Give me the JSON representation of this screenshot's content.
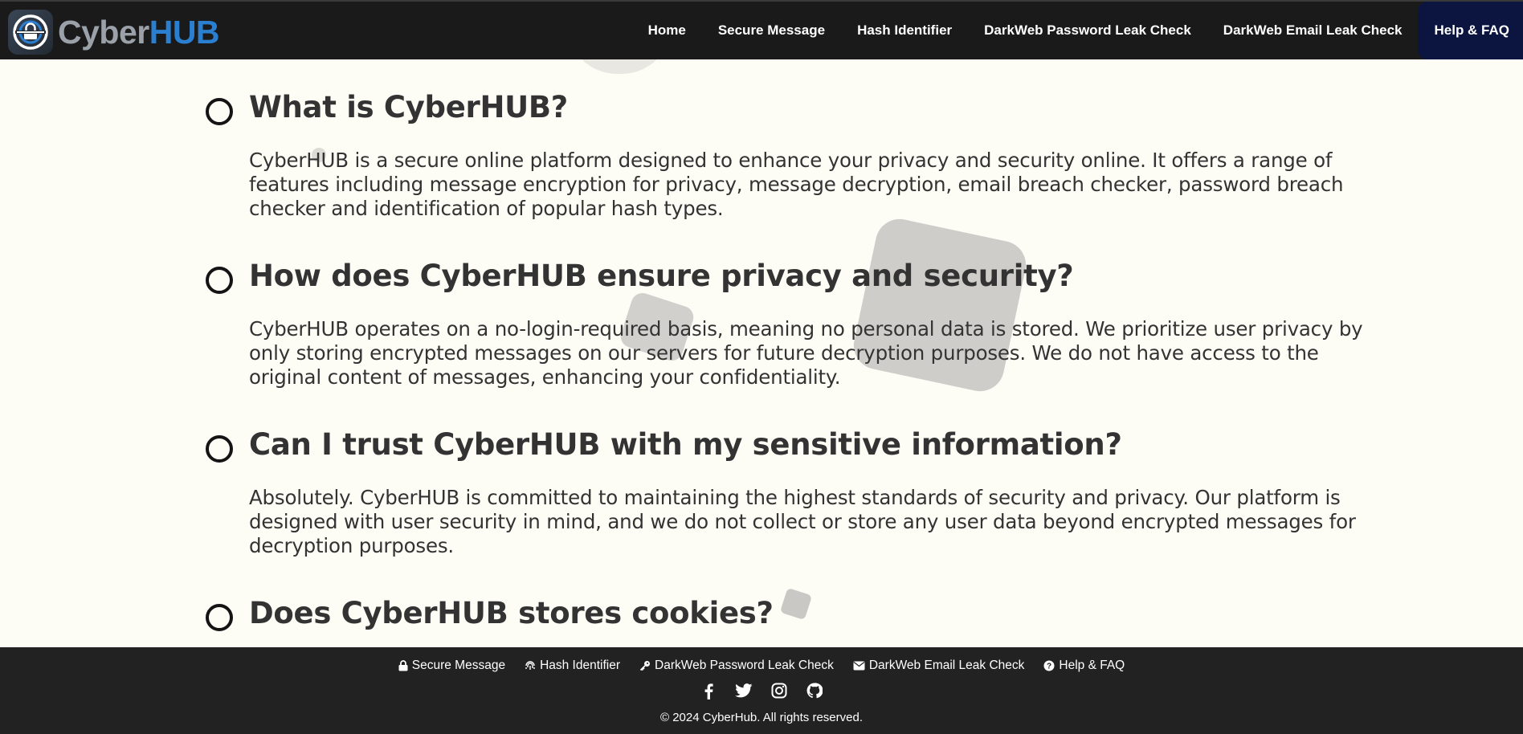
{
  "header": {
    "brand_part1": "Cyber",
    "brand_part2": "HUB",
    "nav": [
      {
        "label": "Home"
      },
      {
        "label": "Secure Message"
      },
      {
        "label": "Hash Identifier"
      },
      {
        "label": "DarkWeb Password Leak Check"
      },
      {
        "label": "DarkWeb Email Leak Check"
      },
      {
        "label": "Help & FAQ",
        "active": true
      }
    ]
  },
  "faq": [
    {
      "question": "What is CyberHUB?",
      "answer": "CyberHUB is a secure online platform designed to enhance your privacy and security online. It offers a range of features including message encryption for privacy, message decryption, email breach checker, password breach checker and identification of popular hash types."
    },
    {
      "question": "How does CyberHUB ensure privacy and security?",
      "answer": "CyberHUB operates on a no-login-required basis, meaning no personal data is stored. We prioritize user privacy by only storing encrypted messages on our servers for future decryption purposes. We do not have access to the original content of messages, enhancing your confidentiality."
    },
    {
      "question": "Can I trust CyberHUB with my sensitive information?",
      "answer": "Absolutely. CyberHUB is committed to maintaining the highest standards of security and privacy. Our platform is designed with user security in mind, and we do not collect or store any user data beyond encrypted messages for decryption purposes."
    },
    {
      "question": "Does CyberHUB stores cookies?",
      "answer": ""
    }
  ],
  "footer": {
    "links": [
      {
        "label": "Secure Message",
        "icon": "lock-icon"
      },
      {
        "label": "Hash Identifier",
        "icon": "fingerprint-icon"
      },
      {
        "label": "DarkWeb Password Leak Check",
        "icon": "key-icon"
      },
      {
        "label": "DarkWeb Email Leak Check",
        "icon": "envelope-icon"
      },
      {
        "label": "Help & FAQ",
        "icon": "question-circle-icon"
      }
    ],
    "socials": [
      "facebook-icon",
      "twitter-icon",
      "instagram-icon",
      "github-icon"
    ],
    "copyright": "© 2024 CyberHub. All rights reserved."
  },
  "colors": {
    "header_bg": "#1a1a1a",
    "active_nav_bg": "#0b1540",
    "brand_blue": "#2b7fd0",
    "page_bg": "#fdfcf5",
    "footer_bg": "#222222"
  }
}
